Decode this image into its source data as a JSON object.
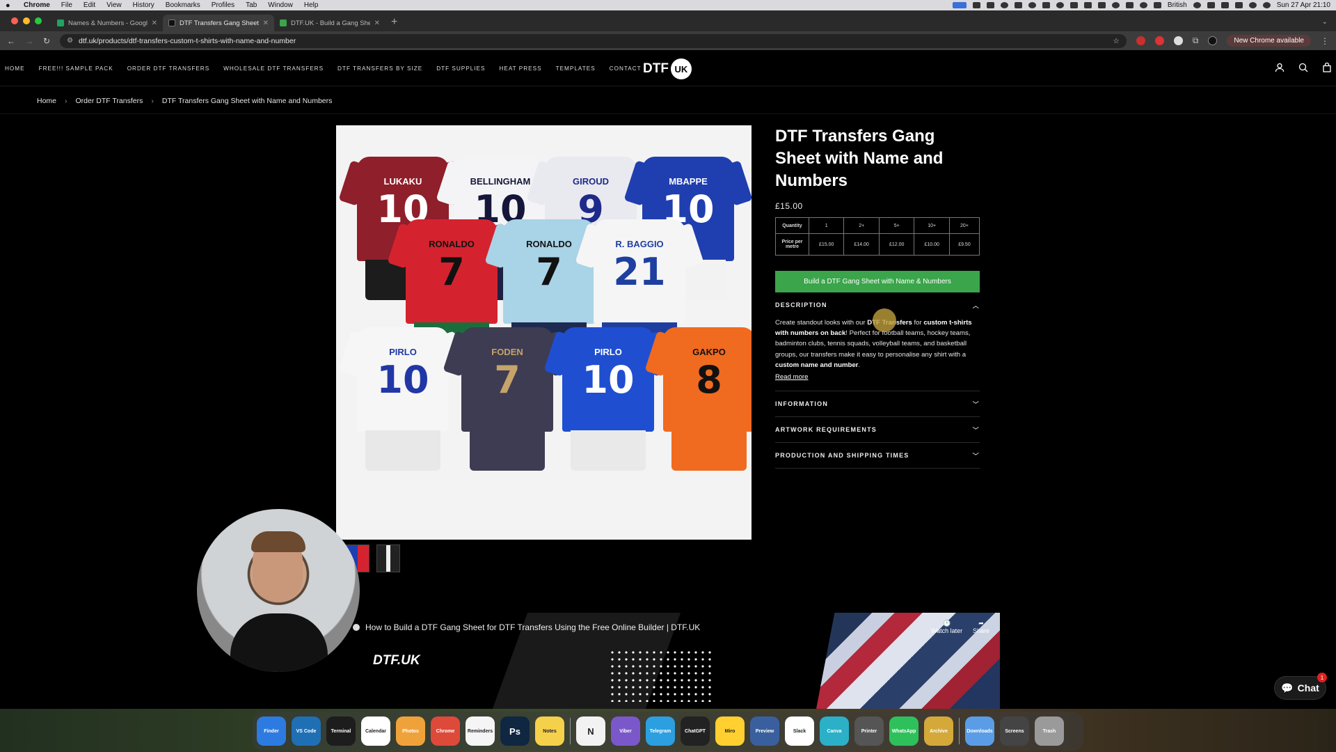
{
  "menubar": {
    "app": "Chrome",
    "items": [
      "File",
      "Edit",
      "View",
      "History",
      "Bookmarks",
      "Profiles",
      "Tab",
      "Window",
      "Help"
    ],
    "input_source": "British",
    "clock": "Sun 27 Apr  21:10"
  },
  "browser": {
    "tabs": [
      {
        "title": "Names & Numbers - Google S",
        "favicon_color": "#1fa463"
      },
      {
        "title": "DTF Transfers Gang Sheet wit",
        "favicon_color": "#111111"
      },
      {
        "title": "DTF.UK - Build a Gang Sheet",
        "favicon_color": "#3aa54a"
      }
    ],
    "url": "dtf.uk/products/dtf-transfers-custom-t-shirts-with-name-and-number",
    "update_label": "New Chrome available"
  },
  "site": {
    "nav": [
      "HOME",
      "FREE!!! SAMPLE PACK",
      "ORDER DTF TRANSFERS",
      "WHOLESALE DTF TRANSFERS",
      "DTF TRANSFERS BY SIZE",
      "DTF SUPPLIES",
      "HEAT PRESS",
      "TEMPLATES",
      "CONTACT"
    ],
    "logo_text": "DTF",
    "logo_badge": "UK"
  },
  "breadcrumb": [
    "Home",
    "Order DTF Transfers",
    "DTF Transfers Gang Sheet with Name and Numbers"
  ],
  "product": {
    "title": "DTF Transfers Gang Sheet with Name and Numbers",
    "price": "£15.00",
    "table": {
      "row1_label": "Quantity",
      "quantities": [
        "1",
        "2+",
        "5+",
        "10+",
        "20+"
      ],
      "row2_label": "Price per metre",
      "prices": [
        "£15.00",
        "£14.00",
        "£12.00",
        "£10.00",
        "£9.50"
      ]
    },
    "cta": "Build a DTF Gang Sheet with Name & Numbers",
    "description": {
      "heading": "DESCRIPTION",
      "p1": "Create standout looks with our ",
      "b1": "DTF Transfers",
      "p2": " for ",
      "b2": "custom t-shirts with numbers on back",
      "p3": "! Perfect for football teams, hockey teams, badminton clubs, tennis squads, volleyball teams, and basketball groups, our transfers make it easy to personalise any shirt with a ",
      "b3": "custom name and number",
      "p4": ".",
      "read_more": "Read more"
    },
    "accordions": [
      "INFORMATION",
      "ARTWORK REQUIREMENTS",
      "PRODUCTION AND SHIPPING TIMES"
    ],
    "jerseys": [
      {
        "name": "LUKAKU",
        "number": "10",
        "shirt": "#8e1f2b",
        "shorts": "#1c1c1c",
        "text": "#ffffff"
      },
      {
        "name": "BELLINGHAM",
        "number": "10",
        "shirt": "#f4f4f6",
        "shorts": "#1d2040",
        "text": "#15163a"
      },
      {
        "name": "GIROUD",
        "number": "9",
        "shirt": "#e9e9f0",
        "shorts": "#ffffff",
        "text": "#1e2a8a"
      },
      {
        "name": "MBAPPE",
        "number": "10",
        "shirt": "#1f3fb0",
        "shorts": "#f2f2f2",
        "text": "#ffffff"
      },
      {
        "name": "RONALDO",
        "number": "7",
        "shirt": "#d4232f",
        "shorts": "#1b6e3b",
        "text": "#111111"
      },
      {
        "name": "RONALDO",
        "number": "7",
        "shirt": "#a9d3e6",
        "shorts": "#1d2b52",
        "text": "#111111"
      },
      {
        "name": "R. BAGGIO",
        "number": "21",
        "shirt": "#f5f5f5",
        "shorts": "#1e3fa0",
        "text": "#1e3fa0"
      },
      {
        "name": "PIRLO",
        "number": "10",
        "shirt": "#f6f6f6",
        "shorts": "#e8e8e8",
        "text": "#2237a6"
      },
      {
        "name": "FODEN",
        "number": "7",
        "shirt": "#3d3c52",
        "shorts": "#3d3c52",
        "text": "#c6a36a"
      },
      {
        "name": "PIRLO",
        "number": "10",
        "shirt": "#1f4fd0",
        "shorts": "#e9e9e9",
        "text": "#ffffff"
      },
      {
        "name": "GAKPO",
        "number": "8",
        "shirt": "#f06a20",
        "shorts": "#f06a20",
        "text": "#111111"
      }
    ]
  },
  "video": {
    "title": "How to Build a DTF Gang Sheet for DTF Transfers Using the Free Online Builder | DTF.UK",
    "brand": "DTF.UK",
    "watch_later": "Watch later",
    "share": "Share"
  },
  "chat": {
    "label": "Chat",
    "badge": "1"
  },
  "dock": [
    {
      "label": "Finder",
      "color": "#2d7be0"
    },
    {
      "label": "VS Code",
      "color": "#1f6fb5"
    },
    {
      "label": "Terminal",
      "color": "#1d1d1d"
    },
    {
      "label": "Calendar",
      "color": "#ffffff"
    },
    {
      "label": "Photos",
      "color": "#f0a23a"
    },
    {
      "label": "Chrome",
      "color": "#dd4a3a"
    },
    {
      "label": "Reminders",
      "color": "#f5f5f5"
    },
    {
      "label": "Ps",
      "color": "#0f2740"
    },
    {
      "label": "Notes",
      "color": "#f5d04a"
    },
    {
      "label": "N",
      "color": "#f2f2f2"
    },
    {
      "label": "Viber",
      "color": "#7b58c9"
    },
    {
      "label": "Telegram",
      "color": "#2c9fe0"
    },
    {
      "label": "ChatGPT",
      "color": "#222222"
    },
    {
      "label": "Miro",
      "color": "#ffd02f"
    },
    {
      "label": "Preview",
      "color": "#3a5f9e"
    },
    {
      "label": "Slack",
      "color": "#ffffff"
    },
    {
      "label": "Canva",
      "color": "#2bb0c8"
    },
    {
      "label": "Printer",
      "color": "#555555"
    },
    {
      "label": "WhatsApp",
      "color": "#2ec15b"
    },
    {
      "label": "Archive",
      "color": "#d4a93a"
    },
    {
      "label": "Downloads",
      "color": "#5a9de6"
    },
    {
      "label": "Screens",
      "color": "#444444"
    },
    {
      "label": "Trash",
      "color": "#9a9a9a"
    }
  ]
}
